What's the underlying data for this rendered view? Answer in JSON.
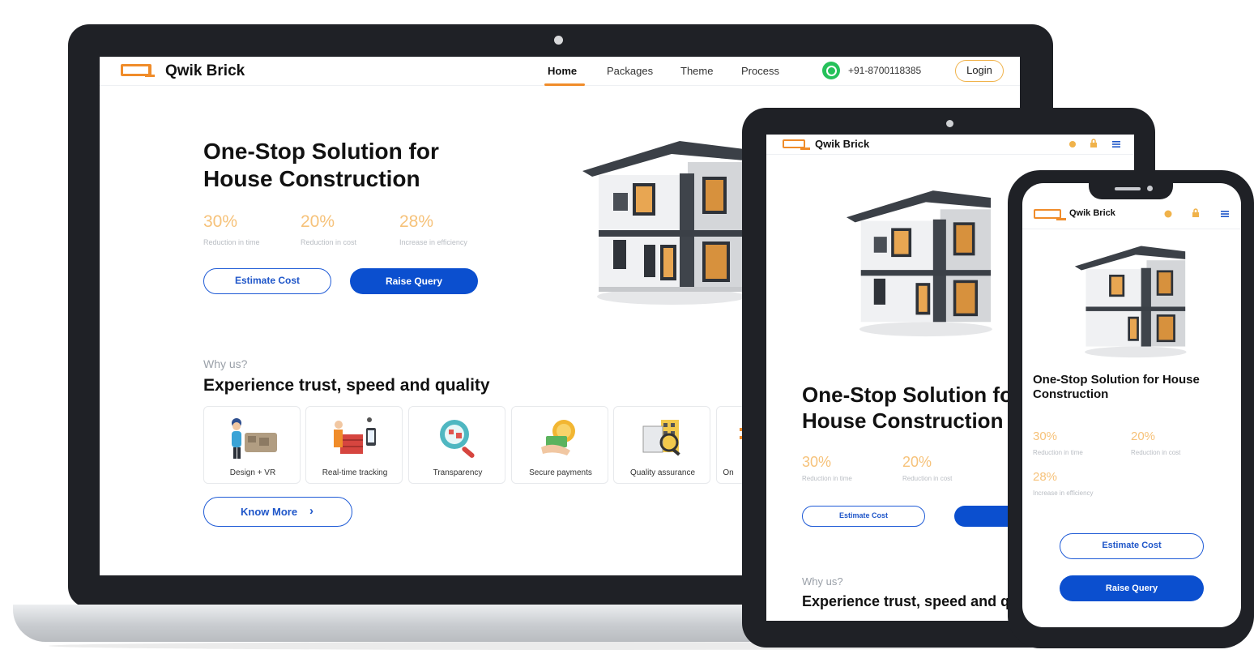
{
  "brand": {
    "name": "Qwik Brick",
    "accent": "#f08c2a",
    "primary": "#0b4fcf"
  },
  "laptop": {
    "nav": {
      "items": [
        {
          "label": "Home",
          "active": true
        },
        {
          "label": "Packages",
          "active": false
        },
        {
          "label": "Theme",
          "active": false
        },
        {
          "label": "Process",
          "active": false
        }
      ],
      "phone": "+91-8700118385",
      "login": "Login"
    },
    "hero": {
      "title_line1": "One-Stop Solution for",
      "title_line2": "House Construction",
      "stats": [
        {
          "value": "30%",
          "label": "Reduction in time"
        },
        {
          "value": "20%",
          "label": "Reduction in cost"
        },
        {
          "value": "28%",
          "label": "Increase in efficiency"
        }
      ],
      "estimate_button": "Estimate Cost",
      "query_button": "Raise Query"
    },
    "why": {
      "label": "Why us?",
      "title": "Experience trust, speed and quality",
      "features": [
        {
          "label": "Design + VR",
          "icon": "design-vr-icon"
        },
        {
          "label": "Real-time tracking",
          "icon": "tracking-icon"
        },
        {
          "label": "Transparency",
          "icon": "transparency-icon"
        },
        {
          "label": "Secure payments",
          "icon": "payments-icon"
        },
        {
          "label": "Quality assurance",
          "icon": "quality-icon"
        },
        {
          "label": "On",
          "icon": "on-time-icon"
        }
      ],
      "know_more": "Know More"
    }
  },
  "tablet": {
    "brand": "Qwik Brick",
    "title_line1": "One-Stop Solution fo",
    "title_line2": "House Construction",
    "stats": [
      {
        "value": "30%",
        "label": "Reduction in time"
      },
      {
        "value": "20%",
        "label": "Reduction in cost"
      }
    ],
    "estimate_button": "Estimate Cost",
    "query_button": "Rai",
    "why_label": "Why us?",
    "why_title": "Experience trust, speed and q"
  },
  "phone": {
    "brand": "Qwik Brick",
    "title_line1": "One-Stop Solution for House",
    "title_line2": "Construction",
    "stats": [
      {
        "value": "30%",
        "label": "Reduction in time"
      },
      {
        "value": "20%",
        "label": "Reduction in cost"
      },
      {
        "value": "28%",
        "label": "Increase in efficiency"
      }
    ],
    "estimate_button": "Estimate Cost",
    "query_button": "Raise Query"
  }
}
